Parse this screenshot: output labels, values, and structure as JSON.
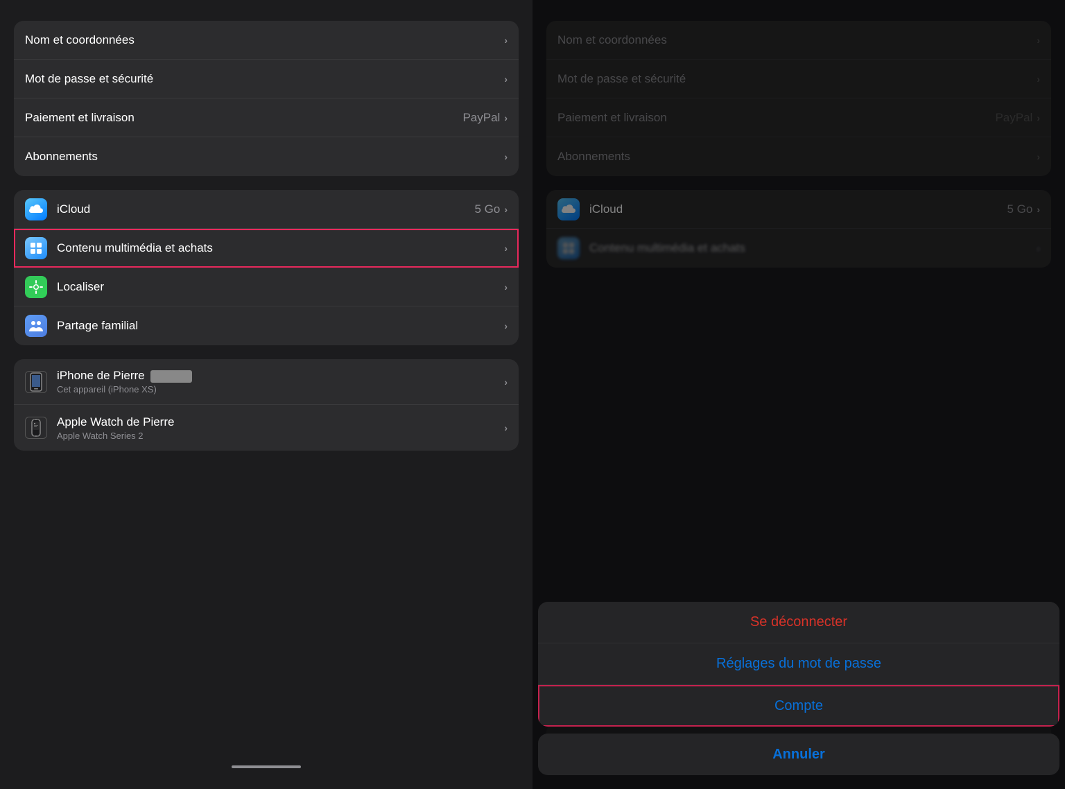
{
  "leftPanel": {
    "group1": {
      "items": [
        {
          "label": "Nom et coordonnées",
          "value": "",
          "hasChevron": true
        },
        {
          "label": "Mot de passe et sécurité",
          "value": "",
          "hasChevron": true
        },
        {
          "label": "Paiement et livraison",
          "value": "PayPal",
          "hasChevron": true
        },
        {
          "label": "Abonnements",
          "value": "",
          "hasChevron": true
        }
      ]
    },
    "group2": {
      "items": [
        {
          "id": "icloud",
          "label": "iCloud",
          "value": "5 Go",
          "hasChevron": true,
          "icon": "icloud"
        },
        {
          "id": "media",
          "label": "Contenu multimédia et achats",
          "value": "",
          "hasChevron": true,
          "icon": "media",
          "highlighted": true
        },
        {
          "id": "find",
          "label": "Localiser",
          "value": "",
          "hasChevron": true,
          "icon": "find"
        },
        {
          "id": "family",
          "label": "Partage familial",
          "value": "",
          "hasChevron": true,
          "icon": "family"
        }
      ]
    },
    "group3": {
      "items": [
        {
          "id": "iphone",
          "label": "iPhone de Pierre",
          "subtitle": "Cet appareil (iPhone XS)",
          "hasChevron": true,
          "icon": "iphone"
        },
        {
          "id": "watch",
          "label": "Apple Watch de Pierre",
          "subtitle": "Apple Watch Series 2",
          "hasChevron": true,
          "icon": "watch"
        }
      ]
    }
  },
  "rightPanel": {
    "group1": {
      "items": [
        {
          "label": "Nom et coordonnées",
          "value": "",
          "hasChevron": true,
          "dimmed": true
        },
        {
          "label": "Mot de passe et sécurité",
          "value": "",
          "hasChevron": true,
          "dimmed": true
        },
        {
          "label": "Paiement et livraison",
          "value": "PayPal",
          "hasChevron": true,
          "dimmed": true
        },
        {
          "label": "Abonnements",
          "value": "",
          "hasChevron": true,
          "dimmed": true
        }
      ]
    },
    "group2": {
      "items": [
        {
          "id": "icloud",
          "label": "iCloud",
          "value": "5 Go",
          "hasChevron": true,
          "icon": "icloud"
        },
        {
          "id": "media",
          "label": "Contenu multimédia et achats",
          "value": "",
          "hasChevron": true,
          "icon": "media",
          "blurred": true
        }
      ]
    },
    "actionSheet": {
      "items": [
        {
          "id": "deconnect",
          "label": "Se déconnecter",
          "color": "red"
        },
        {
          "id": "password",
          "label": "Réglages du mot de passe",
          "color": "blue"
        },
        {
          "id": "compte",
          "label": "Compte",
          "color": "blue",
          "highlighted": true
        }
      ],
      "cancelLabel": "Annuler"
    },
    "group3": {
      "iphone": {
        "label": "iPhone de Pierre ...",
        "subtitle": "Cet appareil (iPhone XS)"
      },
      "watch": {
        "label": "Apple Watch de Pierre",
        "subtitle": "Apple Watch Series 2"
      }
    }
  }
}
